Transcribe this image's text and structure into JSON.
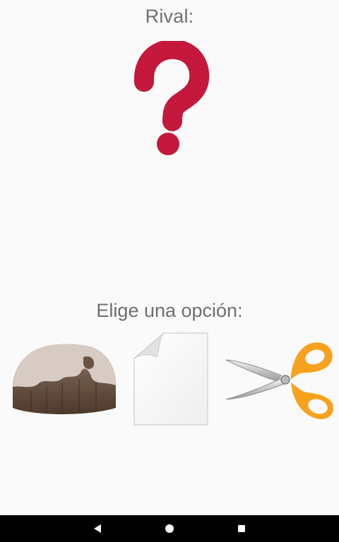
{
  "game": {
    "rival_label": "Rival:",
    "rival_choice_icon": "question-mark-icon",
    "choose_label": "Elige una opción:",
    "options": [
      {
        "icon": "rock-icon"
      },
      {
        "icon": "paper-icon"
      },
      {
        "icon": "scissors-icon"
      }
    ]
  },
  "colors": {
    "background": "#fafafa",
    "text": "#6f6f6f",
    "question_mark": "#c4183c",
    "scissors_handle": "#f6a21e",
    "navbar": "#000000"
  },
  "navbar": {
    "buttons": [
      "back",
      "home",
      "recents"
    ]
  }
}
